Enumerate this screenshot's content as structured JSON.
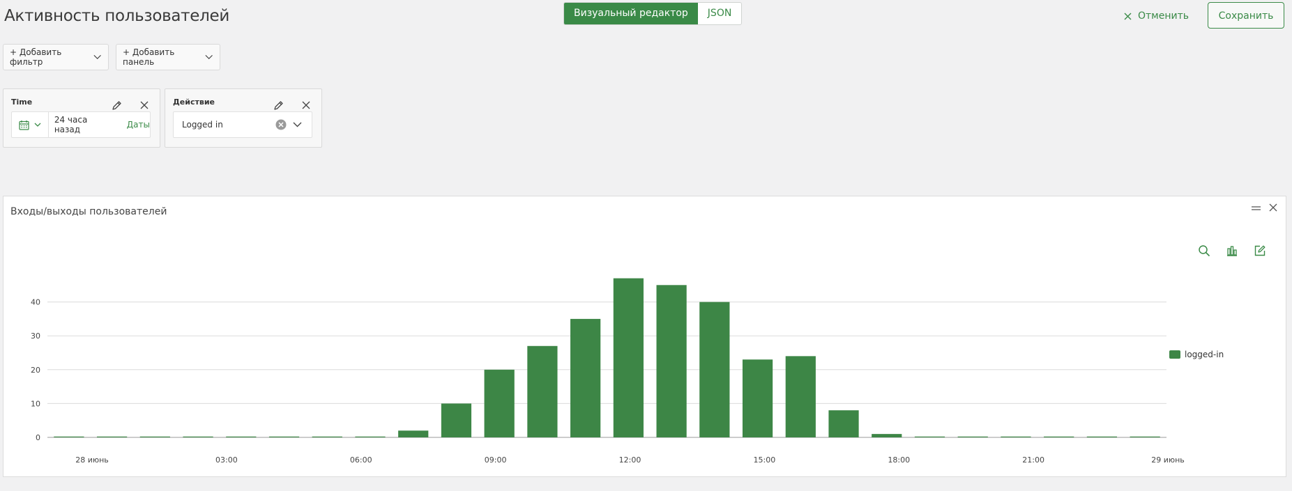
{
  "header": {
    "title": "Активность пользователей",
    "mode_visual": "Визуальный редактор",
    "mode_json": "JSON",
    "cancel_label": "Отменить",
    "save_label": "Сохранить"
  },
  "toolbar": {
    "add_filter": "+ Добавить фильтр",
    "add_panel": "+ Добавить панель"
  },
  "filters": {
    "time": {
      "label": "Time",
      "value": "24 часа назад",
      "dates_link": "Даты"
    },
    "action": {
      "label": "Действие",
      "value": "Logged in"
    }
  },
  "panel": {
    "title": "Входы/выходы пользователей",
    "legend": "logged-in"
  },
  "colors": {
    "accent": "#3a8a47",
    "bar": "#3d8646"
  },
  "chart_data": {
    "type": "bar",
    "x_ticks": [
      "28 июнь",
      "03:00",
      "06:00",
      "09:00",
      "12:00",
      "15:00",
      "18:00",
      "21:00",
      "29 июнь"
    ],
    "series": [
      {
        "name": "logged-in",
        "values": [
          0,
          0,
          0,
          0,
          0,
          0,
          0,
          0,
          2,
          10,
          20,
          27,
          35,
          47,
          45,
          40,
          23,
          24,
          8,
          1,
          0,
          0,
          0,
          0,
          0,
          0
        ]
      }
    ],
    "y_ticks": [
      0,
      10,
      20,
      30,
      40
    ],
    "ylim": [
      0,
      50
    ],
    "grid": true,
    "legend_position": "right"
  }
}
